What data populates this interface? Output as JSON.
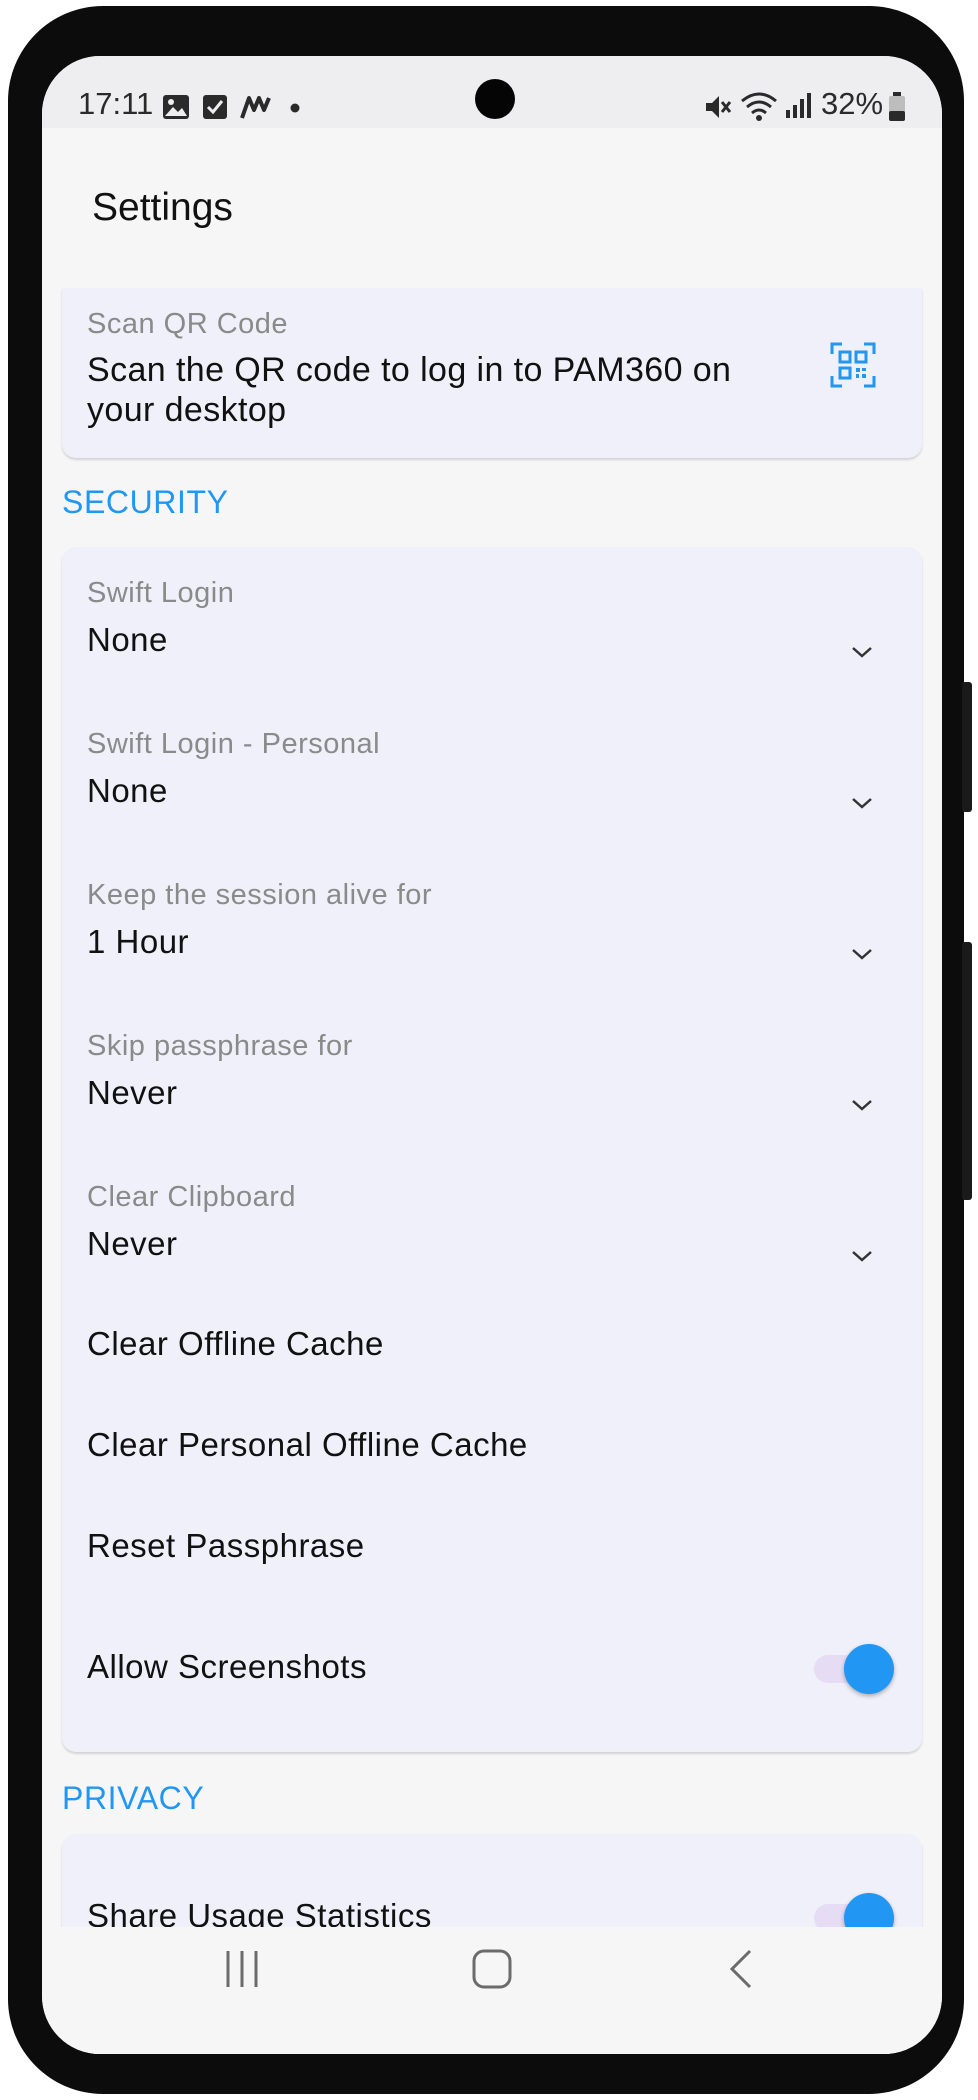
{
  "status_bar": {
    "time": "17:11",
    "battery_percent": "32%",
    "left_icons": [
      "gallery-icon",
      "checkbox-icon",
      "app-icon",
      "dot-icon"
    ],
    "right_icons": [
      "mute-icon",
      "wifi-icon",
      "signal-icon",
      "battery-icon"
    ]
  },
  "app_bar": {
    "title": "Settings"
  },
  "qr_section": {
    "label": "Scan QR Code",
    "description": "Scan the QR code to log in to PAM360 on your desktop",
    "icon": "qr-scan-icon"
  },
  "security": {
    "header": "SECURITY",
    "dropdowns": [
      {
        "label": "Swift Login",
        "value": "None"
      },
      {
        "label": "Swift Login - Personal",
        "value": "None"
      },
      {
        "label": "Keep the session alive for",
        "value": "1 Hour"
      },
      {
        "label": "Skip passphrase for",
        "value": "Never"
      },
      {
        "label": "Clear Clipboard",
        "value": "Never"
      }
    ],
    "actions": [
      "Clear Offline Cache",
      "Clear Personal Offline Cache",
      "Reset Passphrase"
    ],
    "toggle": {
      "label": "Allow Screenshots",
      "enabled": true
    }
  },
  "privacy": {
    "header": "PRIVACY",
    "toggle": {
      "label": "Share Usage Statistics",
      "enabled": true
    }
  },
  "colors": {
    "accent": "#2196f3",
    "card_background": "#f0f0fa",
    "toggle_track": "#e6dcf4"
  },
  "nav_bar": [
    "recents-icon",
    "home-icon",
    "back-icon"
  ]
}
